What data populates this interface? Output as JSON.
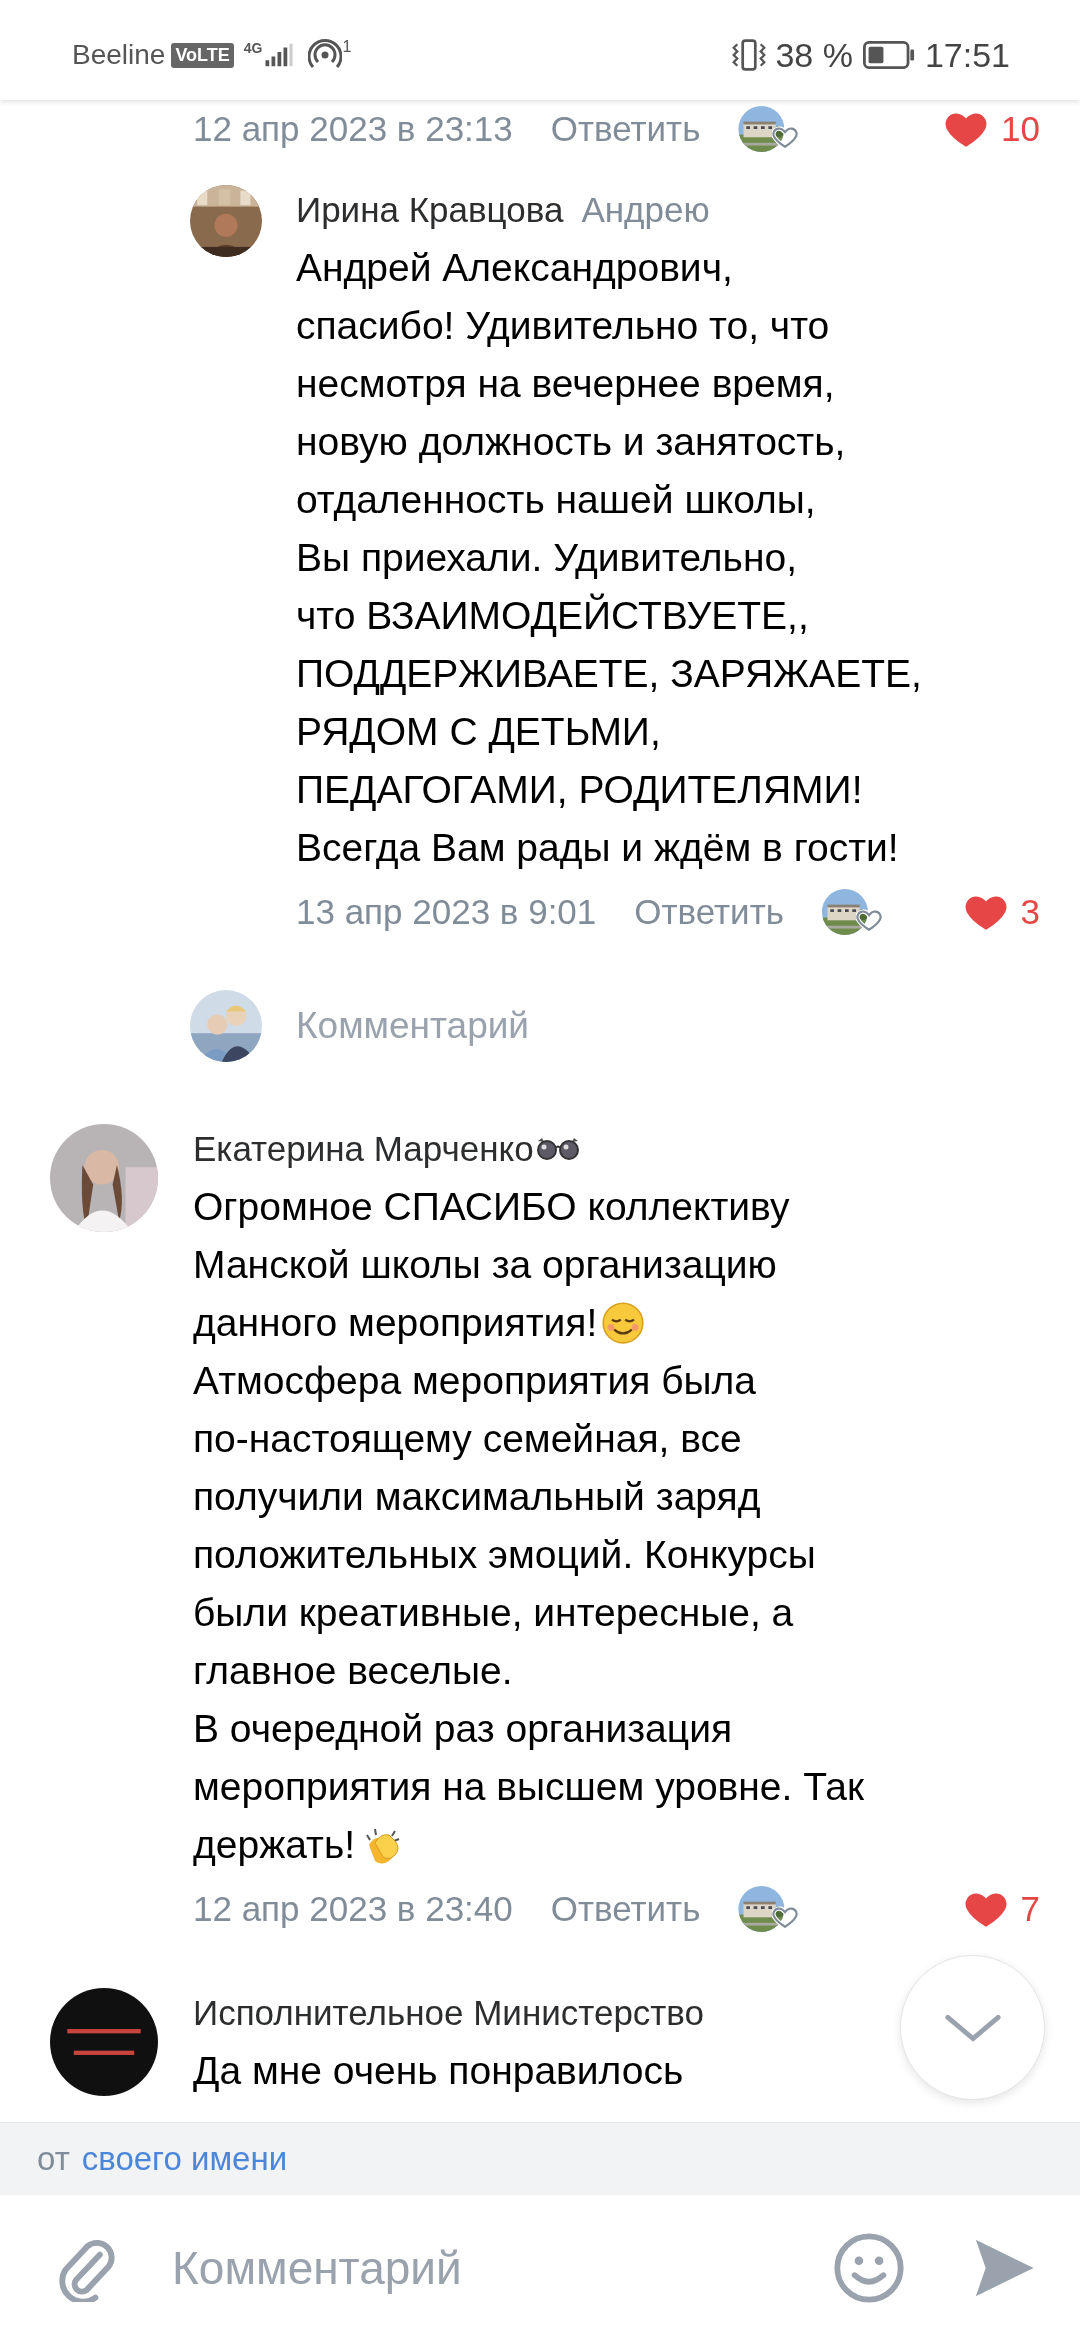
{
  "status_bar": {
    "carrier": "Beeline",
    "network_badge": "VoLTE",
    "network_type": "4G",
    "hotspot_count": "1",
    "battery_percent": "38 %",
    "time": "17:51"
  },
  "comments": [
    {
      "date": "12 апр 2023 в 23:13",
      "reply": "Ответить",
      "likes": "10",
      "liked": true,
      "children": [
        {
          "author": "Ирина Кравцова",
          "addressee": "Андрею",
          "lines": [
            {
              "kind": "plain",
              "text": "Андрей Александрович,"
            },
            {
              "kind": "plain",
              "text": "спасибо! Удивительно то, что"
            },
            {
              "kind": "plain",
              "text": "несмотря на вечернее время,"
            },
            {
              "kind": "plain",
              "text": "новую должность и занятость,"
            },
            {
              "kind": "plain",
              "text": "отдаленность нашей школы,"
            },
            {
              "kind": "plain",
              "text": "Вы приехали. Удивительно,"
            },
            {
              "kind": "plain",
              "text": "что ВЗАИМОДЕЙСТВУЕТЕ,,"
            },
            {
              "kind": "plain",
              "text": "ПОДДЕРЖИВАЕТЕ, ЗАРЯЖАЕТЕ,"
            },
            {
              "kind": "plain",
              "text": "РЯДОМ С ДЕТЬМИ,"
            },
            {
              "kind": "plain",
              "text": "ПЕДАГОГАМИ, РОДИТЕЛЯМИ!"
            },
            {
              "kind": "plain",
              "text": "Всегда Вам рады и ждём в гости!"
            }
          ],
          "date": "13 апр 2023 в 9:01",
          "reply": "Ответить",
          "likes": "3",
          "liked": true
        }
      ],
      "reply_field": {
        "placeholder": "Комментарий"
      }
    },
    {
      "author": "Екатерина Марченко",
      "badge": true,
      "lines": [
        {
          "kind": "plain",
          "text": "Огромное СПАСИБО коллективу"
        },
        {
          "kind": "plain",
          "text": "Манской школы за организацию"
        },
        {
          "kind": "smile",
          "text": "данного мероприятия!"
        },
        {
          "kind": "plain",
          "text": "Атмосфера мероприятия была"
        },
        {
          "kind": "plain",
          "text": "по-настоящему семейная, все"
        },
        {
          "kind": "plain",
          "text": "получили максимальный заряд"
        },
        {
          "kind": "plain",
          "text": "положительных эмоций. Конкурсы"
        },
        {
          "kind": "plain",
          "text": "были креативные, интересные, а"
        },
        {
          "kind": "plain",
          "text": "главное веселые."
        },
        {
          "kind": "plain",
          "text": "В очередной раз организация"
        },
        {
          "kind": "plain",
          "text": "мероприятия на высшем уровне. Так"
        },
        {
          "kind": "clap",
          "text": "держать!"
        }
      ],
      "date": "12 апр 2023 в 23:40",
      "reply": "Ответить",
      "likes": "7",
      "liked": true
    },
    {
      "author": "Исполнительное Министерство",
      "lines": [
        {
          "kind": "plain",
          "text": "Да мне очень понравилось"
        }
      ]
    }
  ],
  "composer": {
    "sender_prefix": "от",
    "sender_link": "своего имени",
    "placeholder": "Комментарий"
  }
}
